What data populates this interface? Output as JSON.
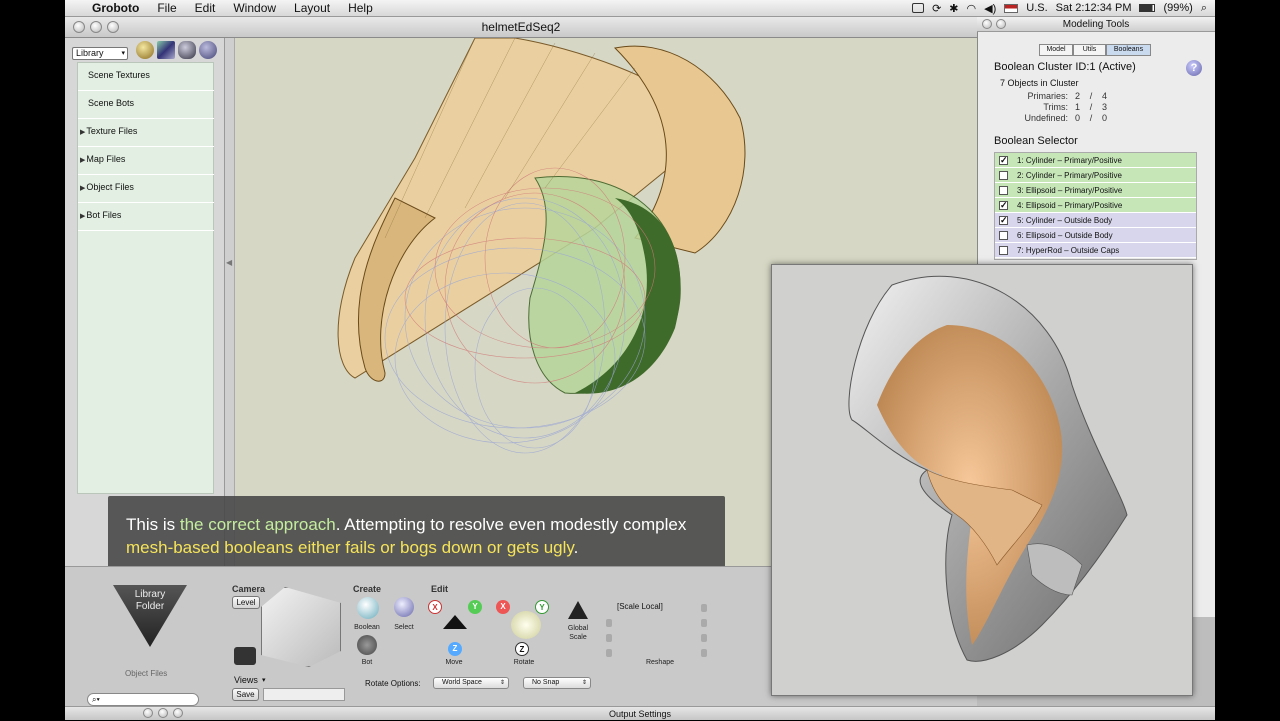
{
  "menubar": {
    "app_name": "Groboto",
    "items": [
      "File",
      "Edit",
      "Window",
      "Layout",
      "Help"
    ],
    "locale": "U.S.",
    "clock": "Sat 2:12:34 PM",
    "battery": "(99%)"
  },
  "window": {
    "title": "helmetEdSeq2"
  },
  "library": {
    "selector": "Library",
    "items": [
      "Scene Textures",
      "Scene Bots",
      "Texture Files",
      "Map Files",
      "Object Files",
      "Bot Files"
    ]
  },
  "caption": {
    "p1": "This is ",
    "h1": "the correct approach",
    "p2": ". Attempting to resolve even modestly complex ",
    "h2": "mesh-based booleans",
    "p3": " ",
    "h3": "either fails or bogs down or gets ugly",
    "p4": "."
  },
  "bottom": {
    "library_folder_line1": "Library",
    "library_folder_line2": "Folder",
    "object_files": "Object Files",
    "camera_label": "Camera",
    "level_button": "Level",
    "views_label": "Views",
    "save_button": "Save",
    "create_label": "Create",
    "boolean_label": "Boolean",
    "select_label": "Select",
    "bot_label": "Bot",
    "edit_label": "Edit",
    "move_label": "Move",
    "rotate_label": "Rotate",
    "global_scale_line1": "Global",
    "global_scale_line2": "Scale",
    "scale_local": "[Scale Local]",
    "reshape_label": "Reshape",
    "rotate_options_label": "Rotate Options:",
    "world_space": "World Space",
    "no_snap": "No Snap",
    "axis_x": "X",
    "axis_y": "Y",
    "axis_z": "Z"
  },
  "status": {
    "output_settings": "Output Settings"
  },
  "modeling_tools": {
    "title": "Modeling Tools",
    "tabs": [
      "Model",
      "Utils",
      "Booleans"
    ],
    "active_tab": "Booleans",
    "cluster_title": "Boolean Cluster ID:1 (Active)",
    "help": "?",
    "objects_count": "7 Objects in Cluster",
    "stats": [
      {
        "label": "Primaries:",
        "a": "2",
        "sep": "/",
        "b": "4"
      },
      {
        "label": "Trims:",
        "a": "1",
        "sep": "/",
        "b": "3"
      },
      {
        "label": "Undefined:",
        "a": "0",
        "sep": "/",
        "b": "0"
      }
    ],
    "selector_title": "Boolean Selector",
    "rows": [
      {
        "label": "1: Cylinder – Primary/Positive",
        "checked": true,
        "color": "#c6e6b8"
      },
      {
        "label": "2: Cylinder – Primary/Positive",
        "checked": false,
        "color": "#c6e6b8"
      },
      {
        "label": "3: Ellipsoid – Primary/Positive",
        "checked": false,
        "color": "#c6e6b8"
      },
      {
        "label": "4: Ellipsoid – Primary/Positive",
        "checked": true,
        "color": "#c6e6b8"
      },
      {
        "label": "5: Cylinder – Outside Body",
        "checked": true,
        "color": "#d7d6ec"
      },
      {
        "label": "6: Ellipsoid – Outside Body",
        "checked": false,
        "color": "#d7d6ec"
      },
      {
        "label": "7: HyperRod – Outside Caps",
        "checked": false,
        "color": "#d7d6ec"
      }
    ]
  }
}
